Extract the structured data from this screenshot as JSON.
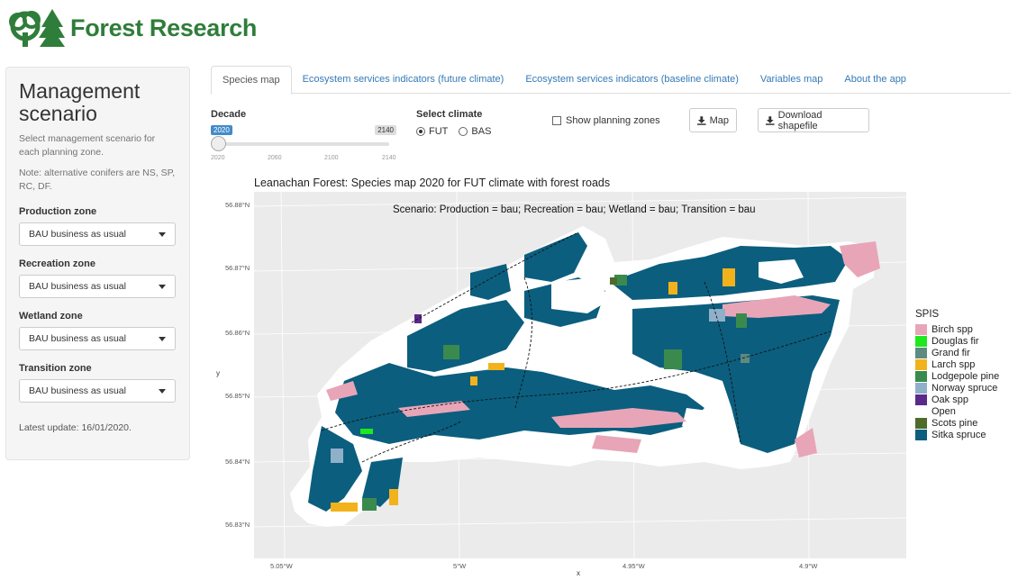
{
  "brand": {
    "name": "Forest Research"
  },
  "sidebar": {
    "title": "Management scenario",
    "help_text": "Select management scenario for each planning zone.",
    "note": "Note: alternative conifers are NS, SP, RC, DF.",
    "zones": [
      {
        "label": "Production zone",
        "value": "BAU business as usual"
      },
      {
        "label": "Recreation zone",
        "value": "BAU business as usual"
      },
      {
        "label": "Wetland zone",
        "value": "BAU business as usual"
      },
      {
        "label": "Transition zone",
        "value": "BAU business as usual"
      }
    ],
    "last_update": "Latest update: 16/01/2020."
  },
  "tabs": [
    {
      "label": "Species map",
      "active": true
    },
    {
      "label": "Ecosystem services indicators (future climate)",
      "active": false
    },
    {
      "label": "Ecosystem services indicators (baseline climate)",
      "active": false
    },
    {
      "label": "Variables map",
      "active": false
    },
    {
      "label": "About the app",
      "active": false
    }
  ],
  "controls": {
    "decade_label": "Decade",
    "decade_value": "2020",
    "decade_max": "2140",
    "decade_ticks": [
      "2020",
      "2060",
      "2100",
      "2140"
    ],
    "climate_label": "Select climate",
    "climate_options": [
      "FUT",
      "BAS"
    ],
    "climate_selected": "FUT",
    "planning_zones_label": "Show planning zones",
    "planning_zones_checked": false,
    "map_button": "Map",
    "download_button": "Download shapefile"
  },
  "map": {
    "title": "Leanachan Forest: Species map 2020 for FUT climate with forest roads",
    "scenario": "Scenario: Production = bau; Recreation = bau; Wetland = bau; Transition = bau",
    "lat_ticks": [
      "56.88°N",
      "56.87°N",
      "56.86°N",
      "56.85°N",
      "56.84°N",
      "56.83°N"
    ],
    "lon_ticks": [
      "5.05°W",
      "5°W",
      "4.95°W",
      "4.9°W"
    ],
    "x_label": "x",
    "y_label": "y"
  },
  "legend": {
    "title": "SPIS",
    "items": [
      {
        "label": "Birch spp",
        "color": "#e8a5b8"
      },
      {
        "label": "Douglas fir",
        "color": "#1ee81e"
      },
      {
        "label": "Grand fir",
        "color": "#5e8a82"
      },
      {
        "label": "Larch spp",
        "color": "#f2b21c"
      },
      {
        "label": "Lodgepole pine",
        "color": "#3a8a4e"
      },
      {
        "label": "Norway spruce",
        "color": "#8fb0c8"
      },
      {
        "label": "Oak spp",
        "color": "#5a2a8a"
      },
      {
        "label": "Open",
        "color": "#ffffff"
      },
      {
        "label": "Scots pine",
        "color": "#4e6b2a"
      },
      {
        "label": "Sitka spruce",
        "color": "#0b5e7e"
      }
    ]
  }
}
